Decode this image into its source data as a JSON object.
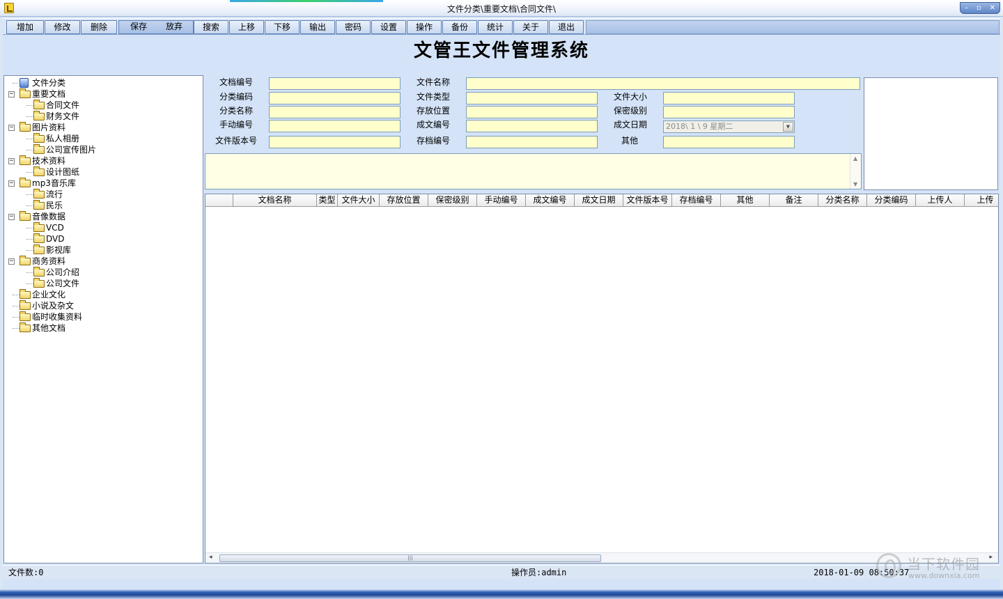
{
  "window": {
    "title": "文件分类\\重要文档\\合同文件\\",
    "controls": [
      "–",
      "▫",
      "✕"
    ]
  },
  "toolbar": {
    "buttons": [
      "增加",
      "修改",
      "删除",
      "保存",
      "放弃",
      "搜索",
      "上移",
      "下移",
      "输出",
      "密码",
      "设置",
      "操作",
      "备份",
      "统计",
      "关于",
      "退出"
    ]
  },
  "heading": "文管王文件管理系统",
  "tree": {
    "root": "文件分类",
    "nodes": [
      {
        "label": "重要文档",
        "level": 1,
        "expander": "−"
      },
      {
        "label": "合同文件",
        "level": 2
      },
      {
        "label": "财务文件",
        "level": 2
      },
      {
        "label": "图片资料",
        "level": 1,
        "expander": "−"
      },
      {
        "label": "私人相册",
        "level": 2
      },
      {
        "label": "公司宣传图片",
        "level": 2
      },
      {
        "label": "技术资料",
        "level": 1,
        "expander": "−"
      },
      {
        "label": "设计图纸",
        "level": 2
      },
      {
        "label": "mp3音乐库",
        "level": 1,
        "expander": "−"
      },
      {
        "label": "流行",
        "level": 2
      },
      {
        "label": "民乐",
        "level": 2
      },
      {
        "label": "音像数据",
        "level": 1,
        "expander": "−"
      },
      {
        "label": "VCD",
        "level": 2
      },
      {
        "label": "DVD",
        "level": 2
      },
      {
        "label": "影视库",
        "level": 2
      },
      {
        "label": "商务资料",
        "level": 1,
        "expander": "−"
      },
      {
        "label": "公司介绍",
        "level": 2
      },
      {
        "label": "公司文件",
        "level": 2
      },
      {
        "label": "企业文化",
        "level": 1
      },
      {
        "label": "小说及杂文",
        "level": 1
      },
      {
        "label": "临时收集资料",
        "level": 1
      },
      {
        "label": "其他文档",
        "level": 1
      }
    ]
  },
  "form": {
    "doc_no": "文档编号",
    "doc_name": "文件名称",
    "cat_code": "分类编码",
    "file_type": "文件类型",
    "file_size": "文件大小",
    "cat_name": "分类名称",
    "location": "存放位置",
    "secret_level": "保密级别",
    "manual_no": "手动编号",
    "draft_no": "成文编号",
    "draft_date": "成文日期",
    "version_no": "文件版本号",
    "archive_no": "存档编号",
    "other": "其他",
    "draft_date_value": "2018\\ 1 \\ 9 星期二"
  },
  "grid": {
    "columns": [
      "",
      "文档名称",
      "类型",
      "文件大小",
      "存放位置",
      "保密级别",
      "手动编号",
      "成文编号",
      "成文日期",
      "文件版本号",
      "存档编号",
      "其他",
      "备注",
      "分类名称",
      "分类编码",
      "上传人",
      "上传"
    ],
    "rows": []
  },
  "status": {
    "file_count": "文件数:0",
    "operator": "操作员:admin",
    "datetime": "2018-01-09 08:50:37"
  },
  "watermark": {
    "text": "当下软件园",
    "url": "www.downxia.com"
  }
}
